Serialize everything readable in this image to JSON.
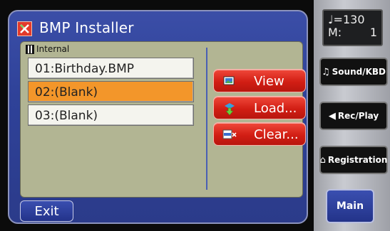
{
  "window": {
    "title": "BMP Installer"
  },
  "storage": {
    "label": "Internal"
  },
  "files": [
    {
      "label": "01:Birthday.BMP",
      "selected": false
    },
    {
      "label": "02:(Blank)",
      "selected": true
    },
    {
      "label": "03:(Blank)",
      "selected": false
    }
  ],
  "actions": {
    "view": "View",
    "load": "Load...",
    "clear": "Clear..."
  },
  "footer": {
    "exit": "Exit"
  },
  "tempo": {
    "note": "♩=130",
    "measure_label": "M:",
    "measure_value": "1"
  },
  "sidebar": {
    "sound_kbd": "Sound/KBD",
    "rec_play": "Rec/Play",
    "registration": "Registration",
    "main": "Main"
  },
  "colors": {
    "screen": "#2f4299",
    "panel": "#b2b593",
    "selected": "#f3962a",
    "button_red": "#d21e14"
  }
}
